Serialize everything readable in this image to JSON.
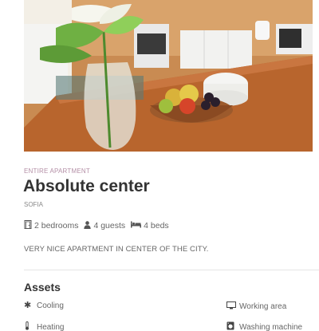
{
  "listing": {
    "photo_alt": "",
    "type": "ENTIRE APARTMENT",
    "title": "Absolute center",
    "city": "SOFIA",
    "features": {
      "bedrooms": "2 bedrooms",
      "guests": "4 guests",
      "beds": "4 beds"
    },
    "description": "VERY NICE APARTMENT IN CENTER OF THE CITY."
  },
  "assets": {
    "title": "Assets",
    "items": [
      {
        "label": "Cooling",
        "icon": "snowflake-icon"
      },
      {
        "label": "Working area",
        "icon": "monitor-icon"
      },
      {
        "label": "Heating",
        "icon": "thermometer-icon"
      },
      {
        "label": "Washing machine",
        "icon": "washing-machine-icon"
      }
    ]
  }
}
